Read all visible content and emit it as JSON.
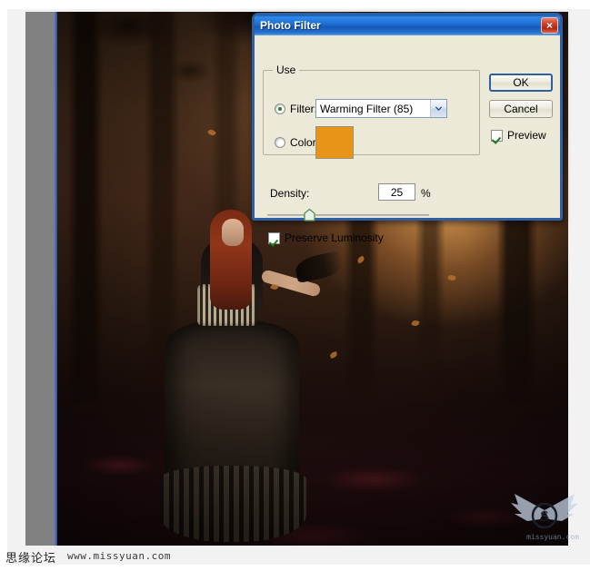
{
  "canvas": {
    "watermark_text": "思缘论坛",
    "watermark_url": "www.missyuan.com",
    "logo_letter": "S"
  },
  "dialog": {
    "title": "Photo Filter",
    "close_icon": "×",
    "use_group": {
      "legend": "Use",
      "filter_radio_label": "Filter:",
      "filter_selected": true,
      "filter_value": "Warming Filter (85)",
      "color_radio_label": "Color:",
      "color_selected": false,
      "color_swatch": "#e8941a"
    },
    "density": {
      "label": "Density:",
      "value": "25",
      "unit": "%",
      "slider_percent": 25
    },
    "preserve_luminosity": {
      "label": "Preserve Luminosity",
      "checked": true
    },
    "buttons": {
      "ok": "OK",
      "cancel": "Cancel"
    },
    "preview": {
      "label": "Preview",
      "checked": true
    }
  }
}
